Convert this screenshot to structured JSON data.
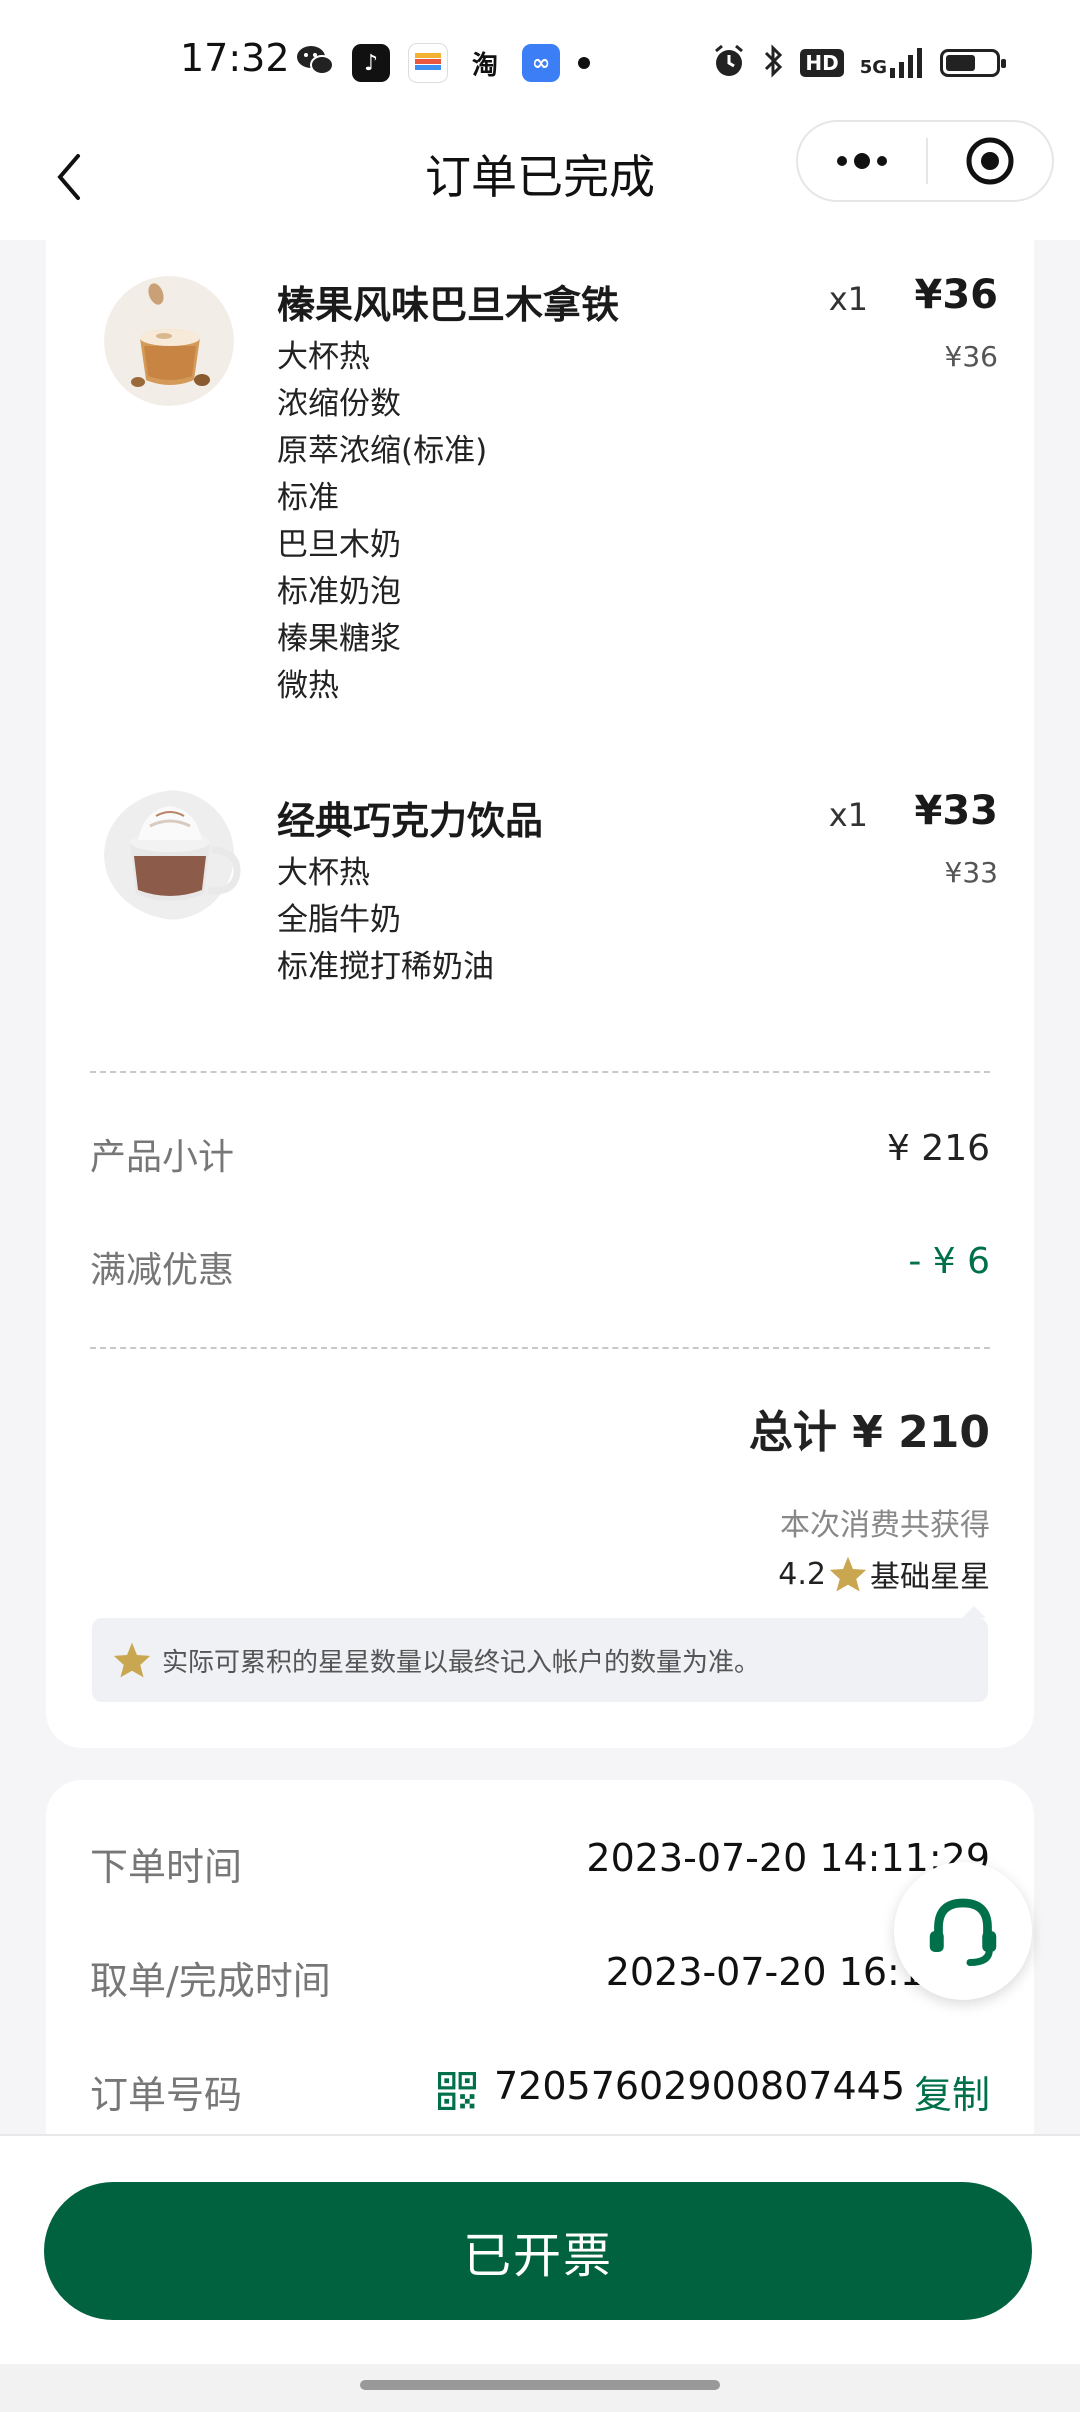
{
  "status_bar": {
    "time": "17:32",
    "apps": [
      "wechat-icon",
      "tiktok-icon",
      "wallet-icon",
      "taobao-icon",
      "infinity-app-icon"
    ],
    "taobao_text": "淘",
    "hd": "HD",
    "network": "5G",
    "battery_level": 0.6
  },
  "nav": {
    "title": "订单已完成"
  },
  "items": [
    {
      "name": "榛果风味巴旦木拿铁",
      "qty": "x1",
      "price": "¥36",
      "unit_price": "¥36",
      "options": [
        "大杯热",
        "浓缩份数",
        "原萃浓缩(标准)",
        "标准",
        "巴旦木奶",
        "标准奶泡",
        "榛果糖浆",
        "微热"
      ]
    },
    {
      "name": "经典巧克力饮品",
      "qty": "x1",
      "price": "¥33",
      "unit_price": "¥33",
      "options": [
        "大杯热",
        "全脂牛奶",
        "标准搅打稀奶油"
      ]
    }
  ],
  "summary": {
    "subtotal_label": "产品小计",
    "subtotal_value": "¥ 216",
    "discount_label": "满减优惠",
    "discount_value": "- ¥ 6",
    "total": "总计 ¥ 210",
    "earn_caption": "本次消费共获得",
    "earn_value": "4.2",
    "earn_unit": "基础星星",
    "note": "实际可累积的星星数量以最终记入帐户的数量为准。"
  },
  "order_info": {
    "order_time_label": "下单时间",
    "order_time_value": "2023-07-20 14:11:29",
    "complete_time_label": "取单/完成时间",
    "complete_time_value": "2023-07-20 16:1",
    "order_no_label": "订单号码",
    "order_no_value": "72057602900807445",
    "copy_label": "复制"
  },
  "footer": {
    "invoice_label": "已开票"
  },
  "colors": {
    "brand_green": "#00623e",
    "accent_green": "#00704a",
    "star_gold": "#c9a650"
  }
}
